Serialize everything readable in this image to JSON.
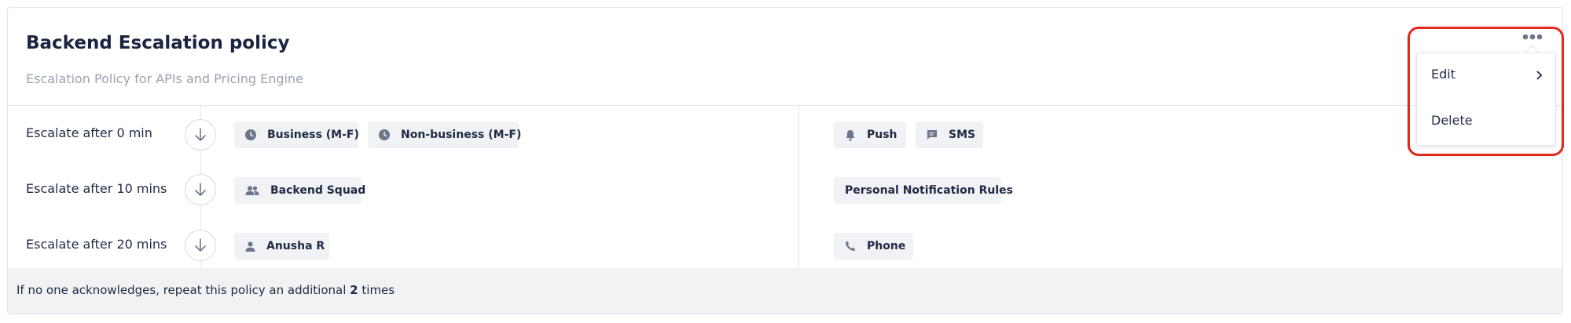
{
  "policy": {
    "title": "Backend Escalation policy",
    "description": "Escalation Policy for APIs and Pricing Engine"
  },
  "steps": [
    {
      "label": "Escalate after 0 min",
      "targets": [
        {
          "icon": "clock-icon",
          "label": "Business (M-F)"
        },
        {
          "icon": "clock-icon",
          "label": "Non-business (M-F)"
        }
      ],
      "notifications": [
        {
          "icon": "bell-icon",
          "label": "Push"
        },
        {
          "icon": "message-icon",
          "label": "SMS"
        }
      ]
    },
    {
      "label": "Escalate after 10 mins",
      "targets": [
        {
          "icon": "team-icon",
          "label": "Backend Squad"
        }
      ],
      "notifications": [
        {
          "icon": "",
          "label": "Personal Notification Rules"
        }
      ]
    },
    {
      "label": "Escalate after 20 mins",
      "targets": [
        {
          "icon": "user-icon",
          "label": "Anusha R"
        }
      ],
      "notifications": [
        {
          "icon": "phone-icon",
          "label": "Phone"
        }
      ]
    }
  ],
  "footer": {
    "prefix": "If no one acknowledges, repeat this policy an additional",
    "count": "2",
    "suffix": "times"
  },
  "menu": {
    "trigger_icon": "more-horizontal-icon",
    "items": [
      {
        "label": "Edit",
        "has_submenu": true
      },
      {
        "label": "Delete",
        "has_submenu": false
      }
    ]
  },
  "colors": {
    "chip_bg": "#f0f2f5",
    "icon": "#6b7688",
    "highlight": "#e5261a",
    "footer_bg": "#f1f2f4"
  }
}
